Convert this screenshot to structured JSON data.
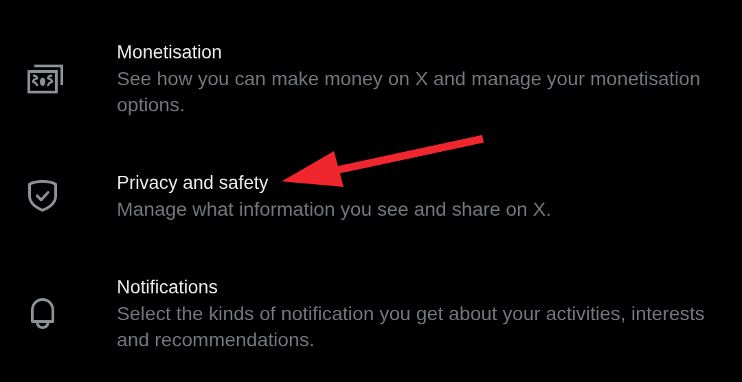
{
  "items": [
    {
      "title": "Monetisation",
      "description": "See how you can make money on X and manage your monetisation options."
    },
    {
      "title": "Privacy and safety",
      "description": "Manage what information you see and share on X."
    },
    {
      "title": "Notifications",
      "description": "Select the kinds of notification you get about your activities, interests and recommendations."
    }
  ]
}
